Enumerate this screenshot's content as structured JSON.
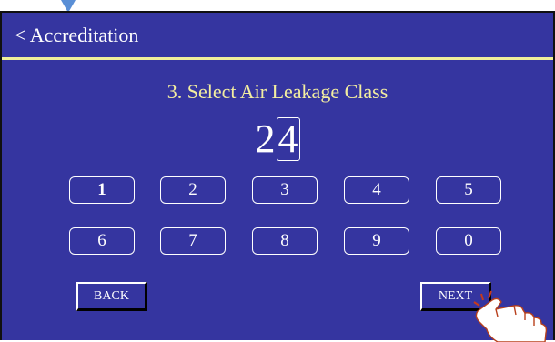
{
  "header": {
    "title": "< Accreditation"
  },
  "step": {
    "title": "3. Select Air Leakage Class"
  },
  "display": {
    "first_digit": "2",
    "cursor_digit": "4"
  },
  "keypad": {
    "keys": [
      "1",
      "2",
      "3",
      "4",
      "5",
      "6",
      "7",
      "8",
      "9",
      "0"
    ],
    "selected": "1"
  },
  "buttons": {
    "back": "BACK",
    "next": "NEXT"
  },
  "colors": {
    "background": "#3535a0",
    "accent_line": "#f0ef9a",
    "title_text": "#f3eea0"
  },
  "icons": {
    "pointer": "pointer-triangle-icon",
    "hand": "pointing-hand-icon"
  }
}
